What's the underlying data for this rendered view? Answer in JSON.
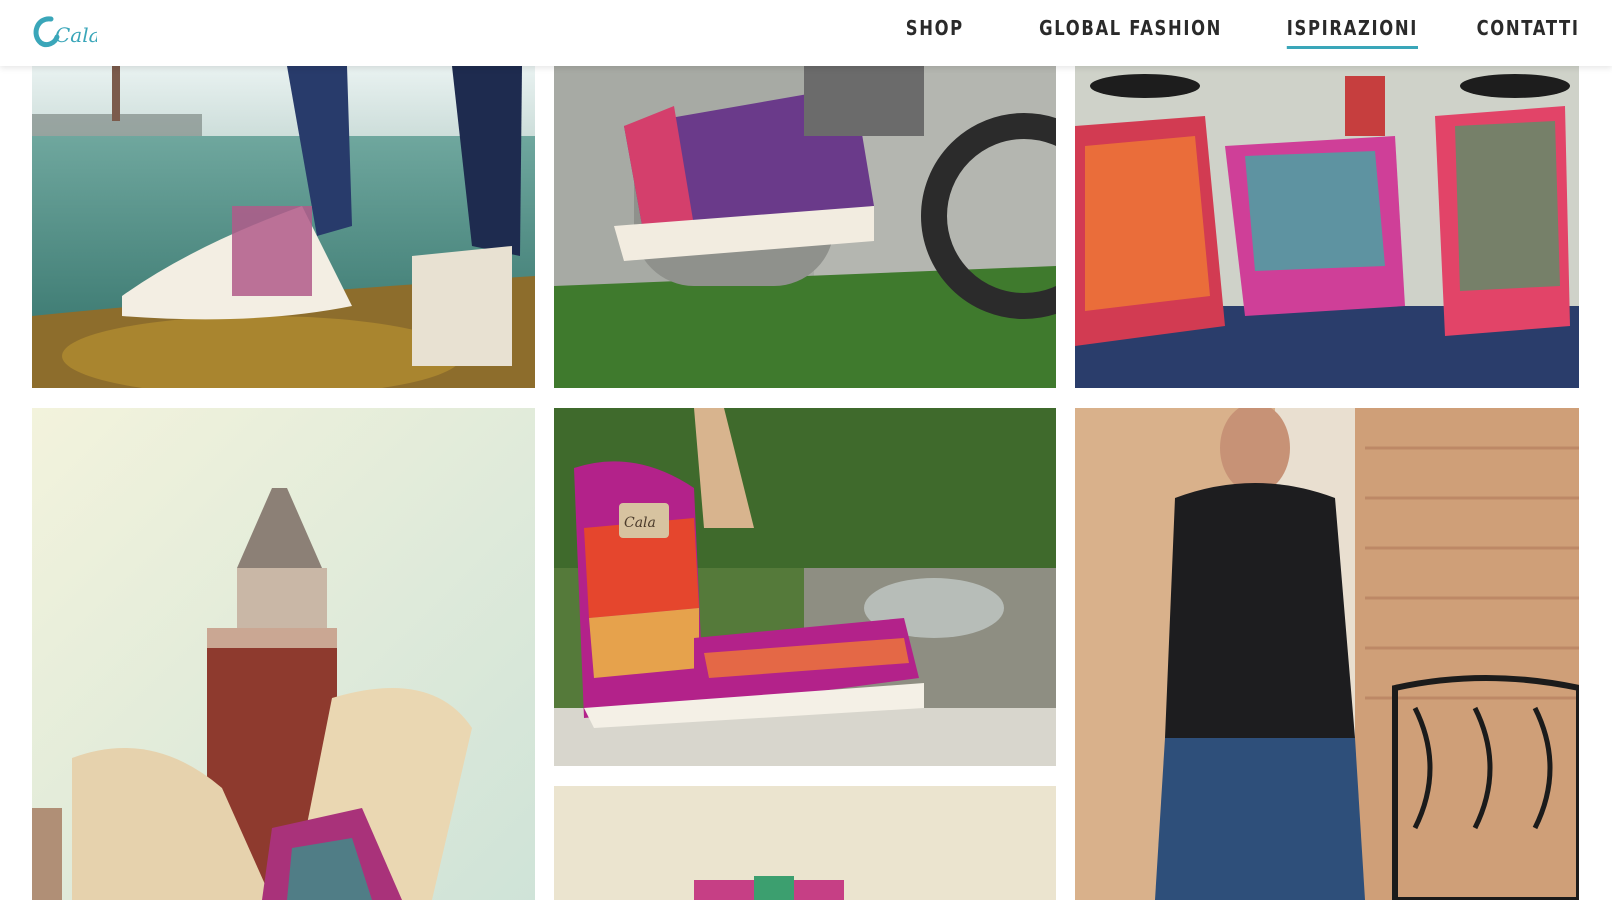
{
  "header": {
    "logo_text": "Cala",
    "nav": [
      {
        "label": "SHOP",
        "active": false
      },
      {
        "label": "GLOBAL FASHION",
        "active": false
      },
      {
        "label": "ISPIRAZIONI",
        "active": true
      },
      {
        "label": "CONTATTI",
        "active": false
      }
    ]
  },
  "brand": {
    "accent": "#3aa6b9"
  },
  "gallery": {
    "images": [
      {
        "subject": "venice-lagoon-sneakers"
      },
      {
        "subject": "bike-pedal-sneaker"
      },
      {
        "subject": "andean-women-textiles"
      },
      {
        "subject": "campanile-sneakers"
      },
      {
        "subject": "garden-sneakers"
      },
      {
        "subject": "man-leather-jacket"
      },
      {
        "subject": "partial-photo"
      }
    ],
    "shoe_label": "Cala"
  }
}
